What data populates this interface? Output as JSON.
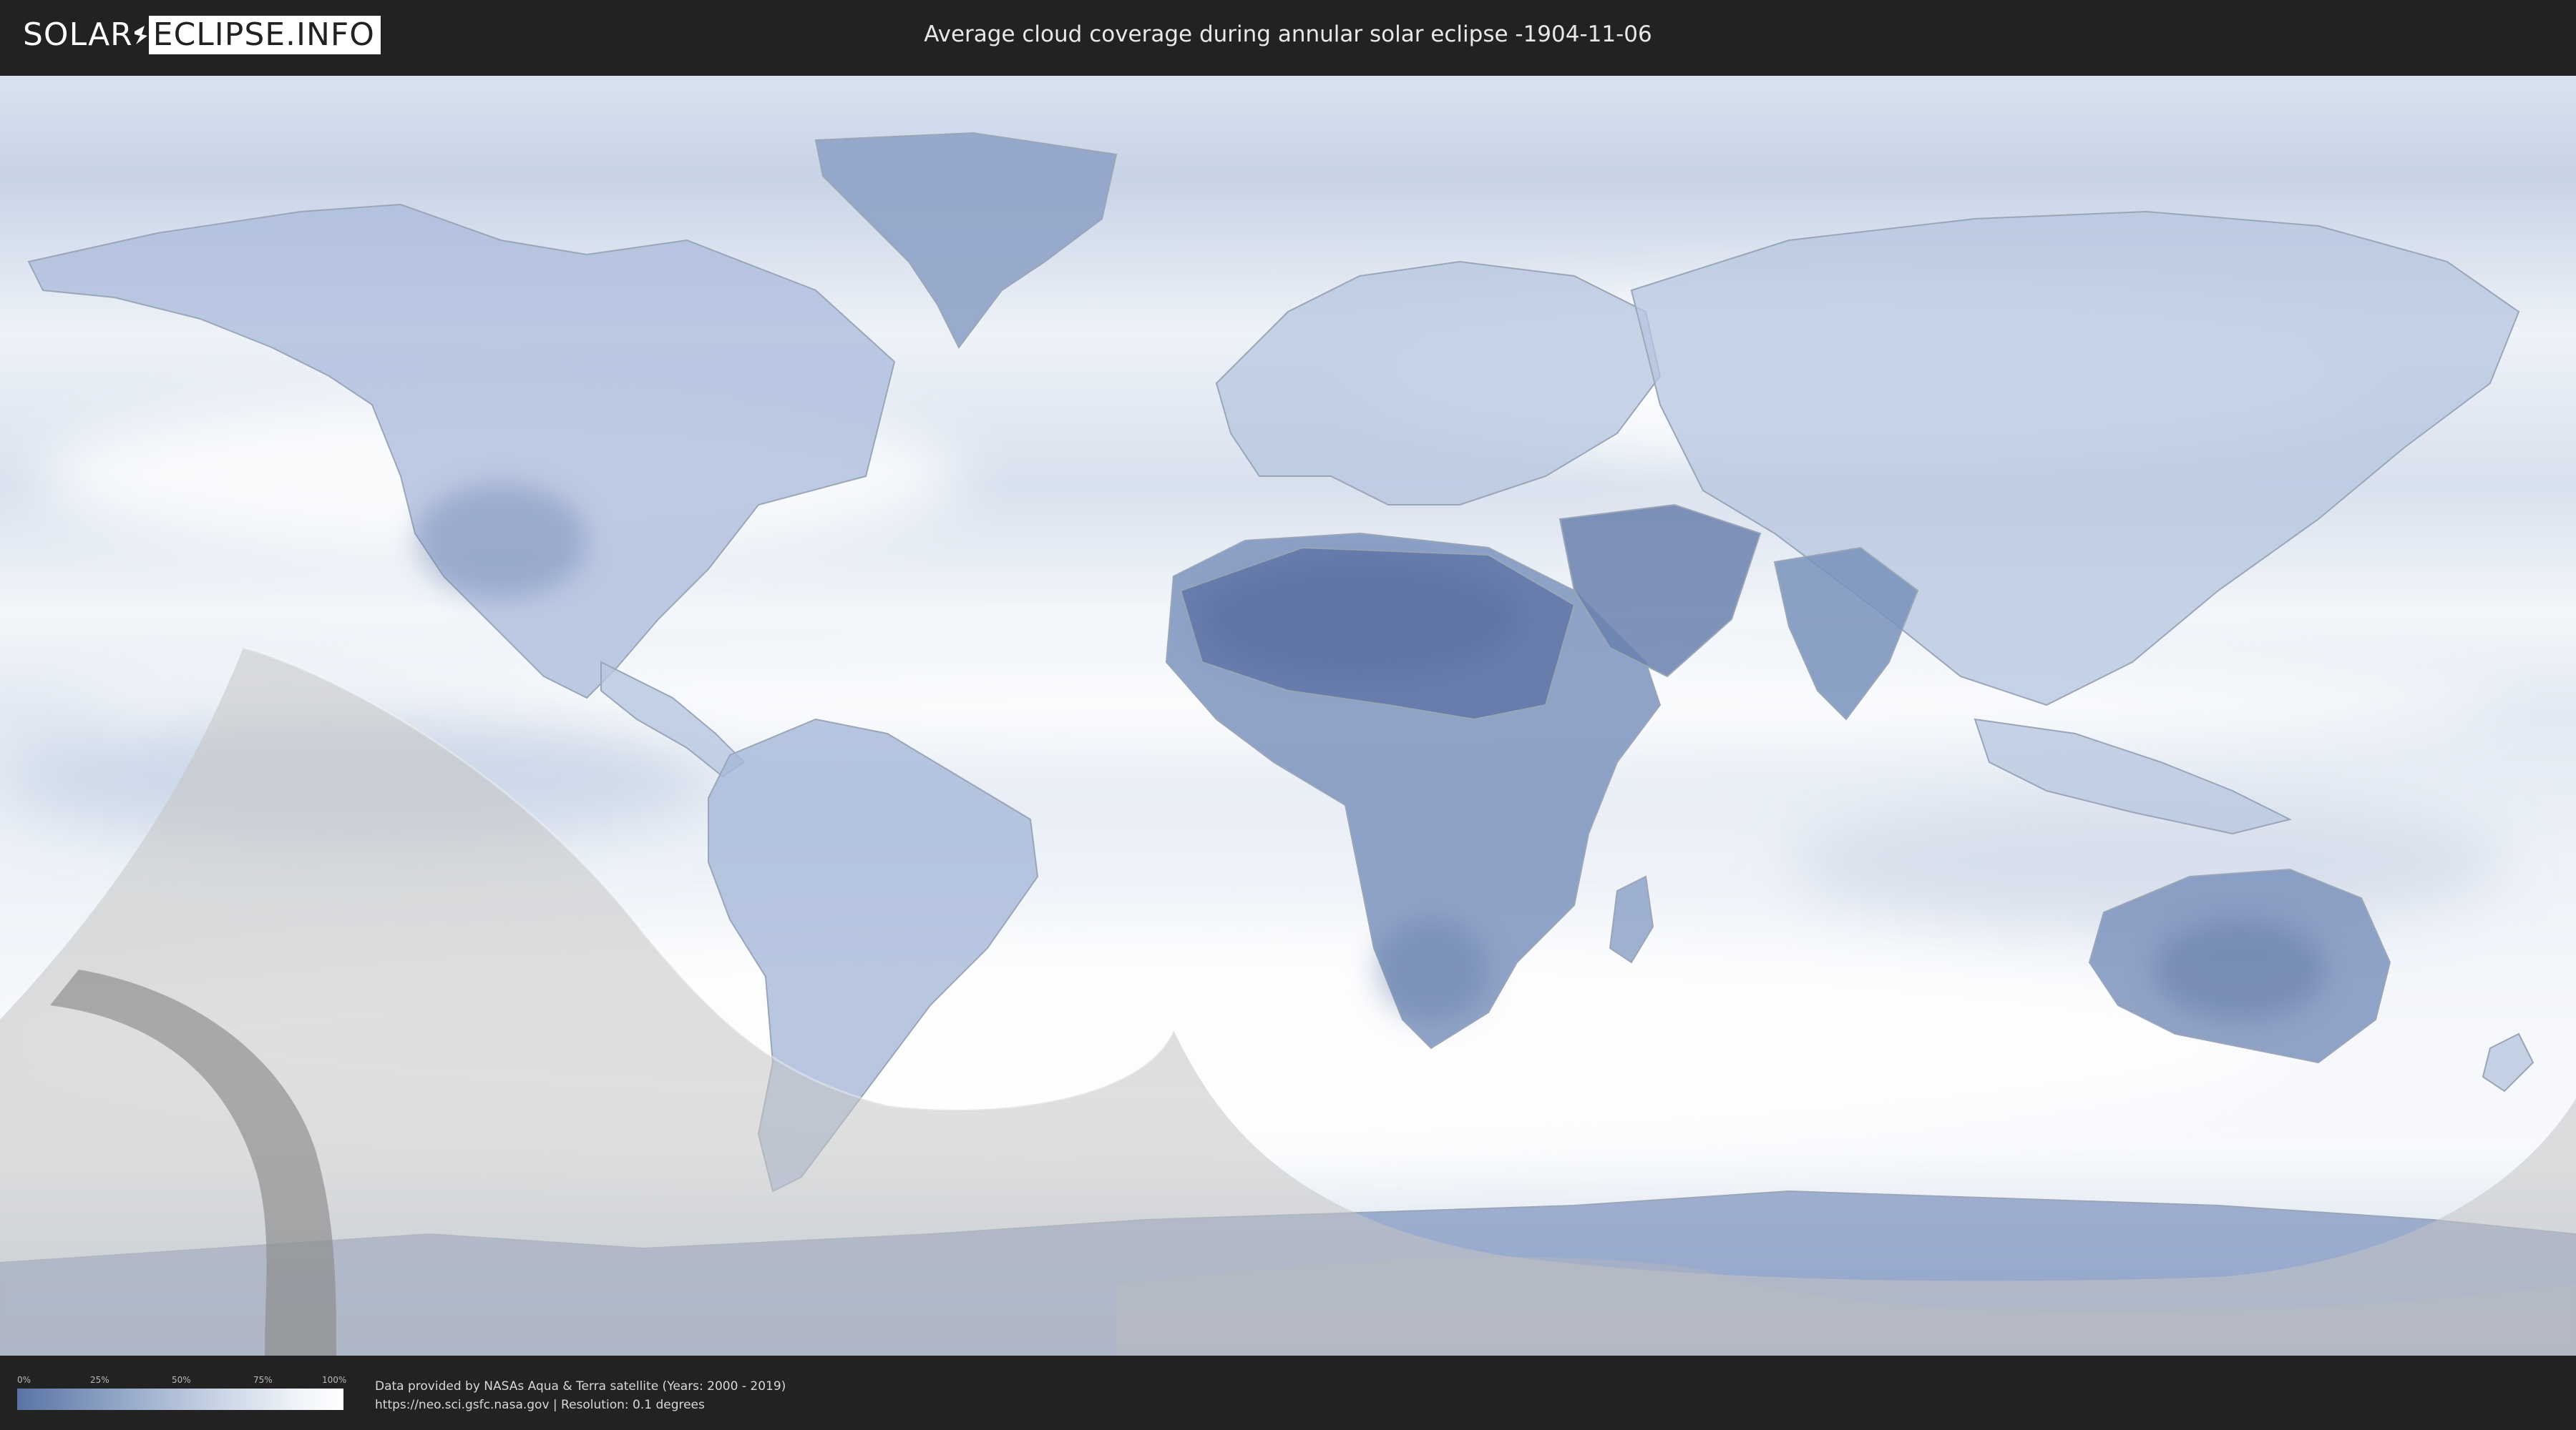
{
  "header": {
    "logo_left": "SOLAR",
    "logo_right": "ECLIPSE.INFO",
    "title": "Average cloud coverage during annular solar eclipse -1904-11-06"
  },
  "map": {
    "subject": "Average cloud coverage world map with eclipse visibility zones",
    "colors": {
      "ocean_clear": "#e9eef6",
      "cloud_white": "#f7f9fc",
      "land_cloudy": "#7d93bd",
      "land_clear": "#5e78a8",
      "eclipse_overlay": "#bdbdbd",
      "path_band": "#8a8a8a",
      "boundary_line": "#9aa6b8"
    }
  },
  "legend": {
    "ticks": [
      "0%",
      "25%",
      "50%",
      "75%",
      "100%"
    ],
    "gradient_colors": [
      "#5a73a3",
      "#8fa4c6",
      "#c6d2e4",
      "#eef2f8",
      "#ffffff"
    ]
  },
  "footer": {
    "credit_line1": "Data provided by NASAs Aqua & Terra satellite (Years: 2000 - 2019)",
    "credit_line2": "https://neo.sci.gsfc.nasa.gov | Resolution: 0.1 degrees"
  }
}
